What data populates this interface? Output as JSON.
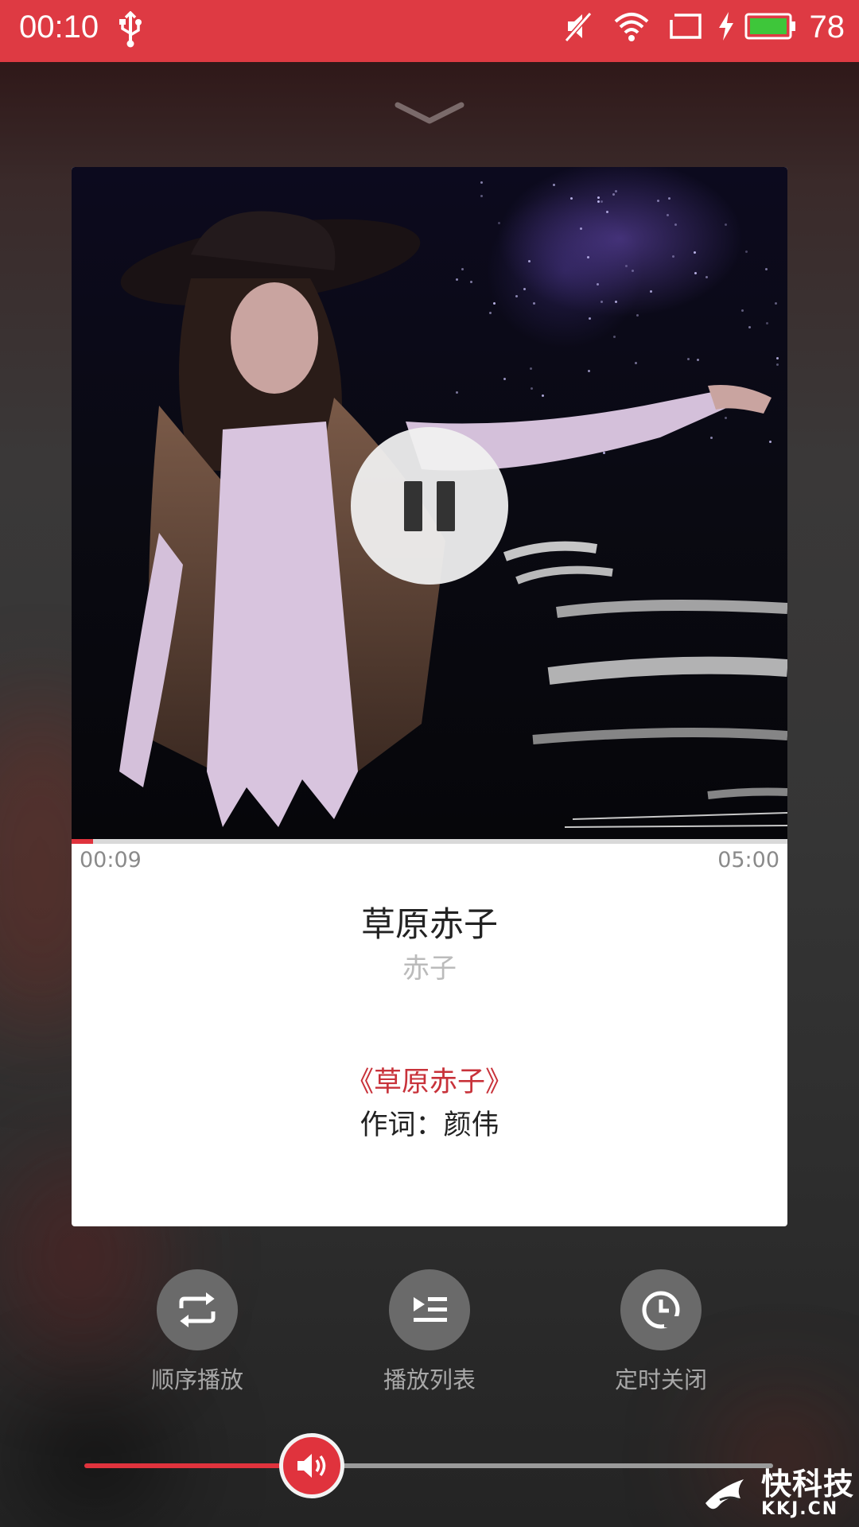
{
  "status_bar": {
    "time": "00:10",
    "battery_level": "78",
    "icons": [
      "usb-icon",
      "mute-icon",
      "wifi-icon",
      "screen-cast-icon",
      "charging-icon",
      "battery-icon"
    ],
    "background_color": "#de3a43"
  },
  "player": {
    "collapse_icon": "chevron-down-icon",
    "cover": {
      "icon": "pause-icon"
    },
    "progress": {
      "current_time": "00:09",
      "total_time": "05:00",
      "fraction": 0.03
    },
    "song": {
      "title": "草原赤子",
      "artist": "赤子"
    },
    "lyrics": [
      {
        "text": "《草原赤子》",
        "highlighted": true
      },
      {
        "text": "作词：颜伟",
        "highlighted": false
      }
    ]
  },
  "controls": [
    {
      "icon": "repeat-icon",
      "label": "顺序播放"
    },
    {
      "icon": "playlist-icon",
      "label": "播放列表"
    },
    {
      "icon": "clock-icon",
      "label": "定时关闭"
    }
  ],
  "volume": {
    "icon": "volume-icon",
    "fraction": 0.33
  },
  "watermark": {
    "cn": "快科技",
    "en": "KKJ.CN"
  },
  "colors": {
    "accent": "#e0333d",
    "lyric_highlight": "#c8323a"
  }
}
